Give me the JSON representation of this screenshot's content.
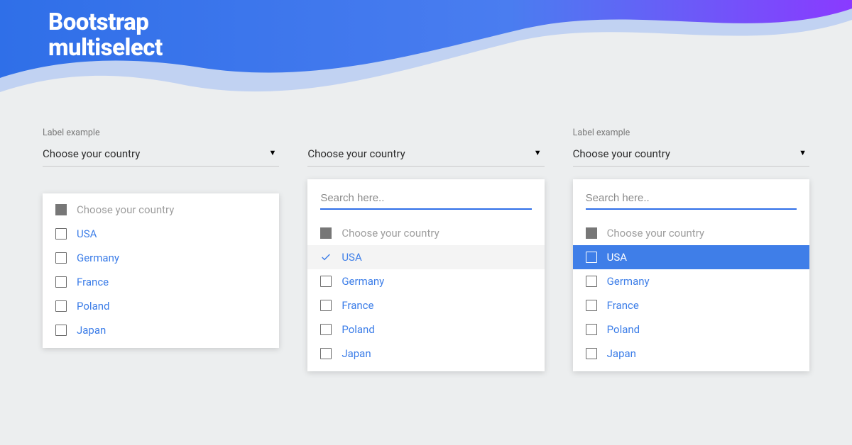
{
  "page_title_line1": "Bootstrap",
  "page_title_line2": "multiselect",
  "labels": {
    "field_label": "Label example",
    "placeholder": "Choose your country",
    "search_placeholder": "Search here..",
    "group_header": "Choose your country"
  },
  "countries": {
    "usa": "USA",
    "germany": "Germany",
    "france": "France",
    "poland": "Poland",
    "japan": "Japan"
  },
  "colors": {
    "accent": "#3f7ee8",
    "gradient_left": "#2f6fe8",
    "gradient_right": "#8a3aff"
  }
}
